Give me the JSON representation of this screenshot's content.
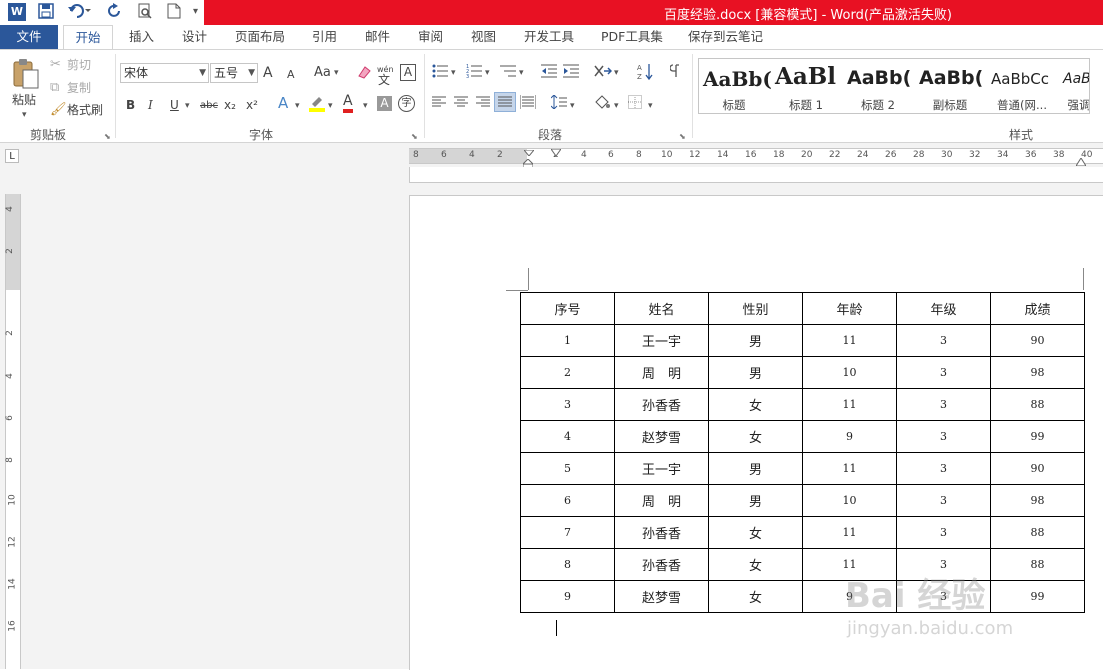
{
  "window": {
    "title": "百度经验.docx [兼容模式] - Word(产品激活失败)",
    "accent": "#2b579a",
    "titlebar_color": "#e81123"
  },
  "quick_access": [
    "word-logo-icon",
    "save-icon",
    "undo-icon",
    "redo-icon",
    "print-preview-icon",
    "new-doc-icon",
    "customize-icon"
  ],
  "tabs": [
    "文件",
    "开始",
    "插入",
    "设计",
    "页面布局",
    "引用",
    "邮件",
    "审阅",
    "视图",
    "开发工具",
    "PDF工具集",
    "保存到云笔记"
  ],
  "ribbon": {
    "clipboard": {
      "paste": "粘贴",
      "cut": "剪切",
      "copy": "复制",
      "format_painter": "格式刷",
      "label": "剪贴板"
    },
    "font": {
      "font_name": "宋体",
      "font_size": "五号",
      "grow": "A",
      "shrink": "A",
      "change_case": "Aa",
      "phonetic_top": "wén",
      "phonetic_bottom": "文",
      "border_char": "A",
      "bold": "B",
      "italic": "I",
      "underline": "U",
      "strike": "abc",
      "subscript": "x₂",
      "superscript": "x²",
      "text_effect": "A",
      "font_color": "A",
      "char_shading": "A",
      "enclose": "字",
      "label": "字体"
    },
    "paragraph": {
      "label": "段落"
    },
    "styles": {
      "label": "样式",
      "items": [
        {
          "sample": "AaBb(",
          "name": "标题"
        },
        {
          "sample": "AaBl",
          "name": "标题 1"
        },
        {
          "sample": "AaBb(",
          "name": "标题 2"
        },
        {
          "sample": "AaBb(",
          "name": "副标题"
        },
        {
          "sample": "AaBbCc",
          "name": "普通(网..."
        },
        {
          "sample": "AaBbC",
          "name": "强调"
        }
      ]
    }
  },
  "ruler": {
    "h_ticks": [
      "8",
      "6",
      "4",
      "2",
      "2",
      "4",
      "6",
      "8",
      "10",
      "12",
      "14",
      "16",
      "18",
      "20",
      "22",
      "24",
      "26",
      "28",
      "30",
      "32",
      "34",
      "36",
      "38",
      "40"
    ],
    "v_ticks": [
      "4",
      "2",
      "2",
      "4",
      "6",
      "8",
      "10",
      "12",
      "14",
      "16"
    ],
    "corner": "L"
  },
  "table": {
    "headers": [
      "序号",
      "姓名",
      "性别",
      "年龄",
      "年级",
      "成绩"
    ],
    "rows": [
      [
        "1",
        "王一宇",
        "男",
        "11",
        "3",
        "90"
      ],
      [
        "2",
        "周　明",
        "男",
        "10",
        "3",
        "98"
      ],
      [
        "3",
        "孙香香",
        "女",
        "11",
        "3",
        "88"
      ],
      [
        "4",
        "赵梦雪",
        "女",
        "9",
        "3",
        "99"
      ],
      [
        "5",
        "王一宇",
        "男",
        "11",
        "3",
        "90"
      ],
      [
        "6",
        "周　明",
        "男",
        "10",
        "3",
        "98"
      ],
      [
        "7",
        "孙香香",
        "女",
        "11",
        "3",
        "88"
      ],
      [
        "8",
        "孙香香",
        "女",
        "11",
        "3",
        "88"
      ],
      [
        "9",
        "赵梦雪",
        "女",
        "9",
        "3",
        "99"
      ]
    ]
  },
  "watermark": {
    "main": "Bai 经验",
    "sub": "jingyan.baidu.com"
  }
}
